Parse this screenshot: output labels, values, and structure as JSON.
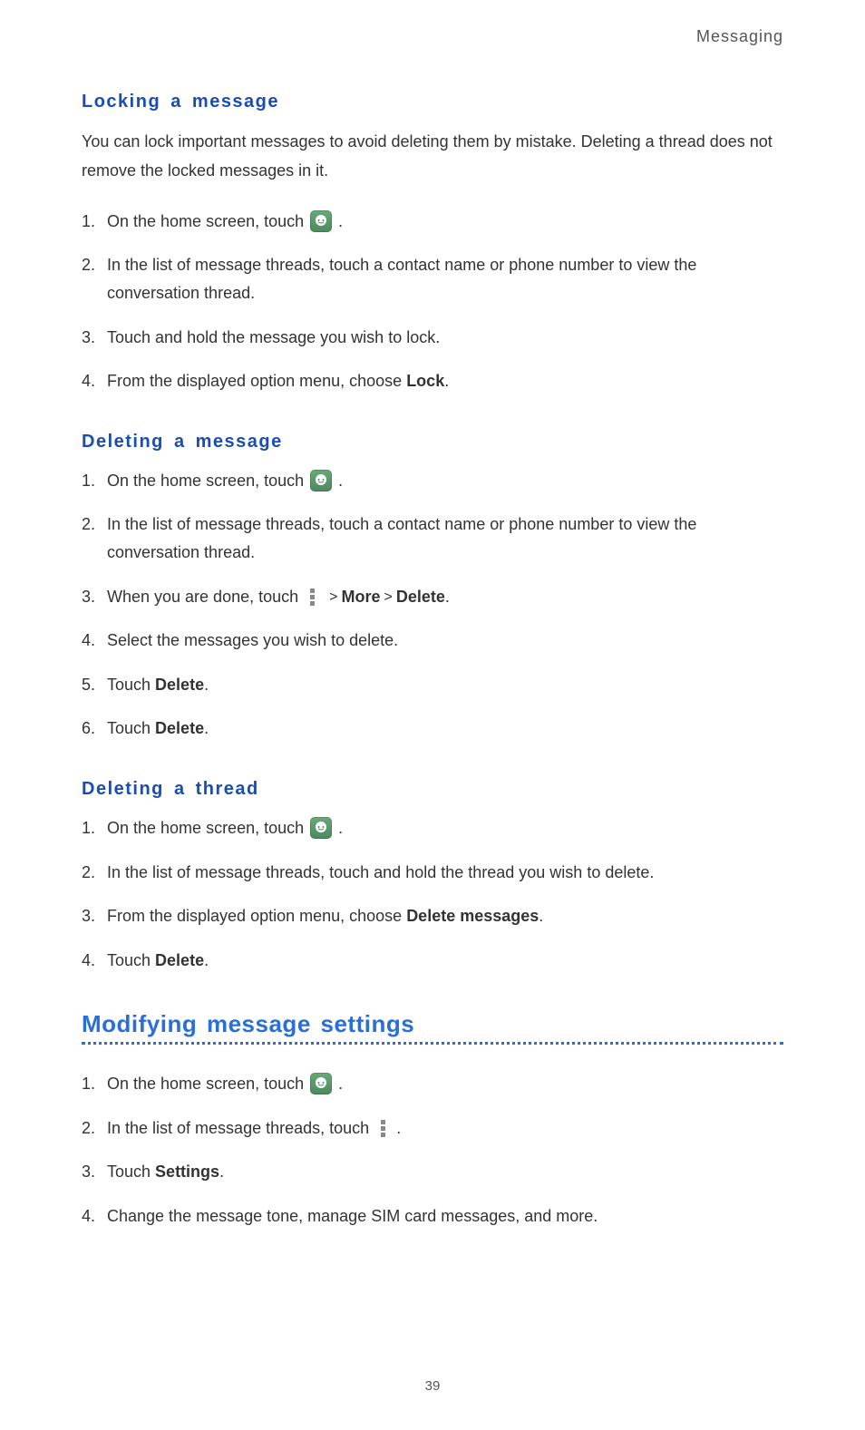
{
  "header": {
    "title": "Messaging"
  },
  "sections": {
    "locking": {
      "title": "Locking a message",
      "intro": "You can lock important messages to avoid deleting them by mistake. Deleting a thread does not remove the locked messages in it.",
      "steps": {
        "s1a": "On the home screen, touch ",
        "s1b": ".",
        "s2": "In the list of message threads, touch a contact name or phone number to view the conversation thread.",
        "s3": "Touch and hold the message you wish to lock.",
        "s4a": "From the displayed option menu, choose ",
        "s4b": "Lock",
        "s4c": "."
      }
    },
    "deleting_msg": {
      "title": "Deleting a message",
      "steps": {
        "s1a": "On the home screen, touch ",
        "s1b": ".",
        "s2": "In the list of message threads, touch a contact name or phone number to view the conversation thread.",
        "s3a": "When you are done, touch ",
        "s3b": "More",
        "s3c": "Delete",
        "s3d": ".",
        "gt": ">",
        "s4": "Select the messages you wish to delete.",
        "s5a": "Touch ",
        "s5b": "Delete",
        "s5c": ".",
        "s6a": "Touch ",
        "s6b": "Delete",
        "s6c": "."
      }
    },
    "deleting_thread": {
      "title": "Deleting a thread",
      "steps": {
        "s1a": "On the home screen, touch ",
        "s1b": ".",
        "s2": "In the list of message threads, touch and hold the thread you wish to delete.",
        "s3a": "From the displayed option menu, choose ",
        "s3b": "Delete messages",
        "s3c": ".",
        "s4a": "Touch ",
        "s4b": "Delete",
        "s4c": "."
      }
    },
    "modifying": {
      "title": "Modifying message settings",
      "steps": {
        "s1a": "On the home screen, touch ",
        "s1b": ".",
        "s2a": "In the list of message threads, touch ",
        "s2b": ".",
        "s3a": "Touch ",
        "s3b": "Settings",
        "s3c": ".",
        "s4": "Change the message tone, manage SIM card messages, and more."
      }
    }
  },
  "page_number": "39"
}
